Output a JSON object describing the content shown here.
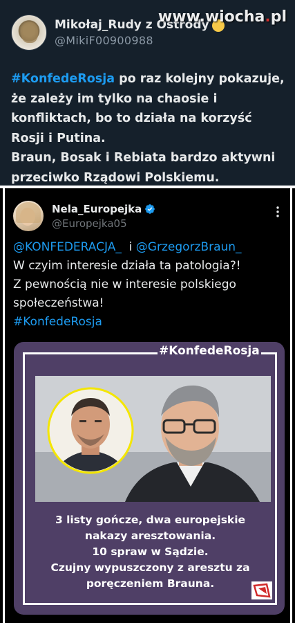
{
  "watermark": {
    "text_before_dot": "www.wiocha",
    "dot": ".",
    "text_after_dot": "pl"
  },
  "top_tweet": {
    "author_name": "Mikołaj_Rudy z Ostródy",
    "author_emoji": "smiling-face-emoji",
    "author_handle": "@MikiF00900988",
    "hashtag": "#KonfedeRosja",
    "text_after_hashtag": " po raz kolejny pokazuje, że zależy im tylko na chaosie i konfliktach, bo to działa na korzyść Rosji i Putina.",
    "text_second_paragraph": "Braun, Bosak i Rebiata bardzo aktywni przeciwko Rządowi Polskiemu."
  },
  "second_tweet": {
    "author_name": "Nela_Europejka",
    "verified_icon": "verified-badge-icon",
    "author_handle": "@Europejka05",
    "more_icon": "more-options-icon",
    "mention_1": "@KONFEDERACJA_",
    "mention_2": "@GrzegorzBraun_",
    "line_1": "W czyim interesie działa ta patologia?!",
    "line_2": "Z pewnością nie w interesie polskiego społeczeństwa!",
    "hashtag": "#KonfedeRosja"
  },
  "card": {
    "hashtag": "#KonfedeRosja",
    "caption_1": "3 listy gończe, dwa europejskie",
    "caption_2": "nakazy aresztowania.",
    "caption_3": "10 spraw w Sądzie.",
    "caption_4": "Czujny wypuszczony z aresztu za",
    "caption_5": "poręczeniem Brauna."
  },
  "colors": {
    "top_bg": "#15202b",
    "link_blue": "#1d9bf0",
    "card_bg": "#4f3f66",
    "highlight_ring": "#f4e600"
  }
}
